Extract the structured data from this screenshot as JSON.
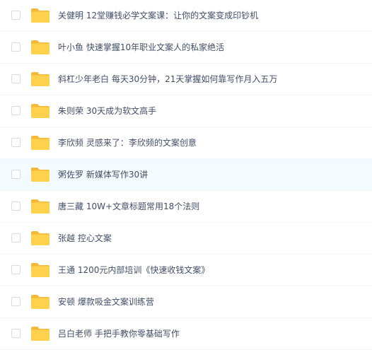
{
  "icon": "folder-icon",
  "colors": {
    "folder_front": "#ffd24d",
    "folder_back": "#f6b83a",
    "hover_row": "#f4fbff",
    "text": "#424e67"
  },
  "files": [
    {
      "name": "关健明 12堂赚钱必学文案课：让你的文案变成印钞机"
    },
    {
      "name": "叶小鱼 快速掌握10年职业文案人的私家绝活"
    },
    {
      "name": "斜杠少年老白 每天30分钟，21天掌握如何靠写作月入五万"
    },
    {
      "name": "朱则荣 30天成为软文高手"
    },
    {
      "name": "李欣频 灵感来了：李欣频的文案创意"
    },
    {
      "name": "粥佐罗 新媒体写作30讲",
      "hovered": true
    },
    {
      "name": "唐三藏 10W+文章标题常用18个法则"
    },
    {
      "name": "张越 控心文案"
    },
    {
      "name": "王通 1200元内部培训《快速收钱文案》"
    },
    {
      "name": "安顿 爆款吸金文案训练营"
    },
    {
      "name": "吕白老师 手把手教你零基础写作"
    }
  ]
}
